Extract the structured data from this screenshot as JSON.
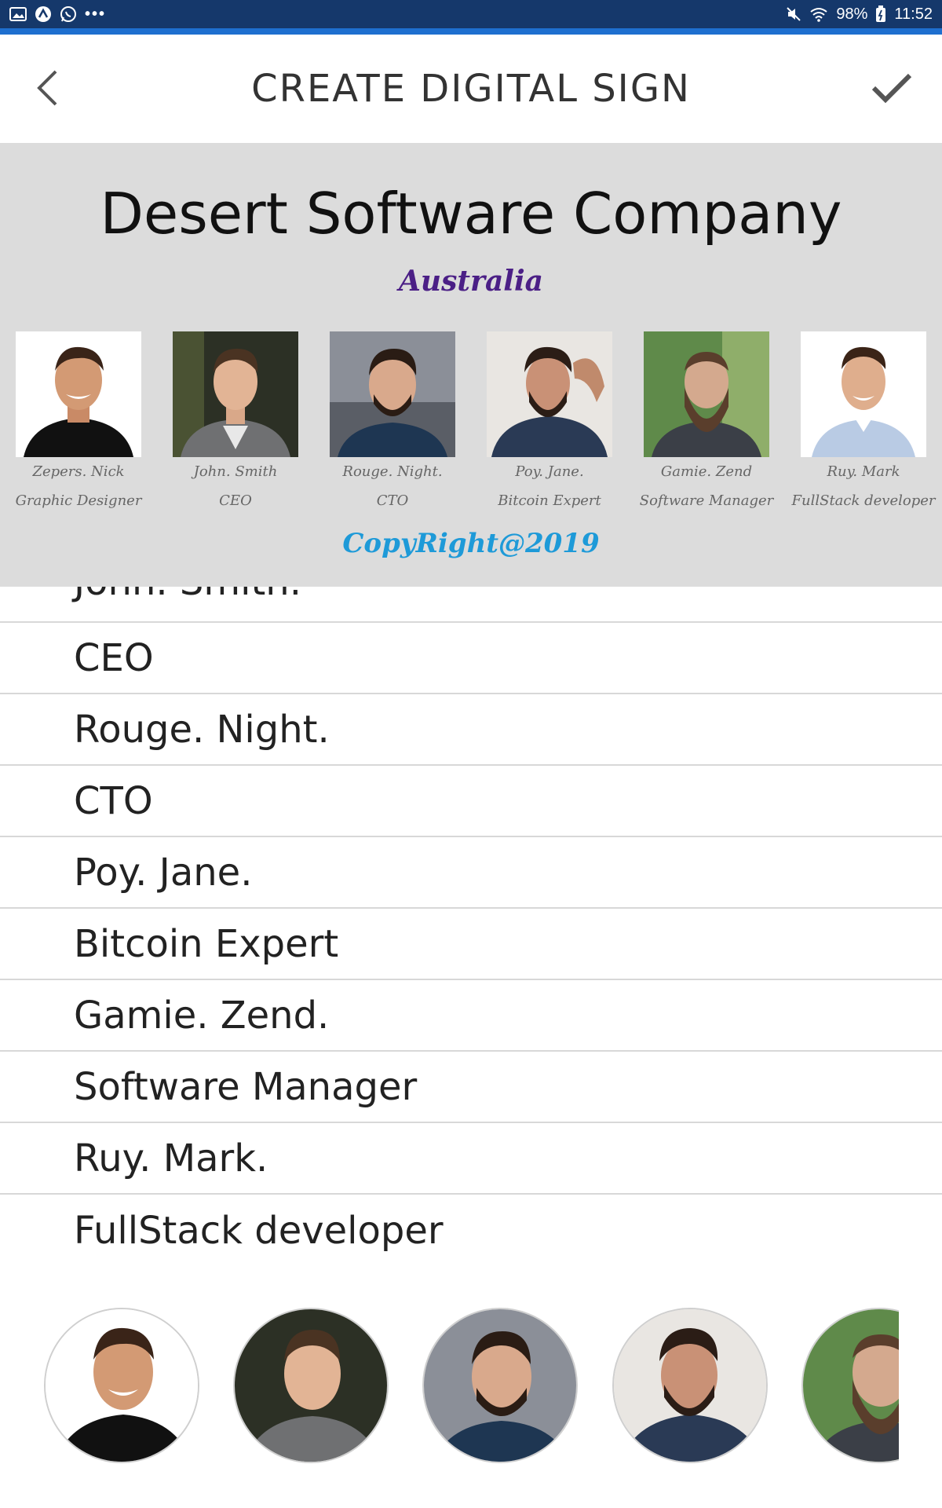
{
  "status_bar": {
    "battery": "98%",
    "time": "11:52",
    "left_icons": [
      "gallery-icon",
      "app-icon",
      "whatsapp-icon",
      "more-dots-icon"
    ],
    "right_icons": [
      "mute-icon",
      "wifi-icon",
      "battery-icon"
    ],
    "bg_color": "#15386b",
    "accent_color": "#1e6fcf"
  },
  "app_bar": {
    "title": "CREATE DIGITAL SIGN",
    "back_icon": "chevron-left-icon",
    "confirm_icon": "check-icon"
  },
  "sign": {
    "company": "Desert Software Company",
    "location": "Australia",
    "copyright": "CopyRight@2019",
    "background": "#dcdcdc",
    "location_color": "#4b1f86",
    "copyright_color": "#1e9ad8",
    "staff": [
      {
        "name": "Zepers. Nick",
        "role": "Graphic Designer"
      },
      {
        "name": "John. Smith",
        "role": "CEO"
      },
      {
        "name": "Rouge. Night.",
        "role": "CTO"
      },
      {
        "name": "Poy. Jane.",
        "role": "Bitcoin Expert"
      },
      {
        "name": "Gamie. Zend",
        "role": "Software Manager"
      },
      {
        "name": "Ruy. Mark",
        "role": "FullStack developer"
      }
    ]
  },
  "list": {
    "partial_item": "John. Smith.",
    "items": [
      "CEO",
      "Rouge. Night.",
      "CTO",
      "Poy. Jane.",
      "Bitcoin Expert",
      "Gamie. Zend.",
      "Software Manager",
      "Ruy. Mark.",
      "FullStack developer"
    ]
  },
  "avatars": [
    "avatar-zepers-nick",
    "avatar-john-smith",
    "avatar-rouge-night",
    "avatar-poy-jane",
    "avatar-gamie-zend"
  ]
}
